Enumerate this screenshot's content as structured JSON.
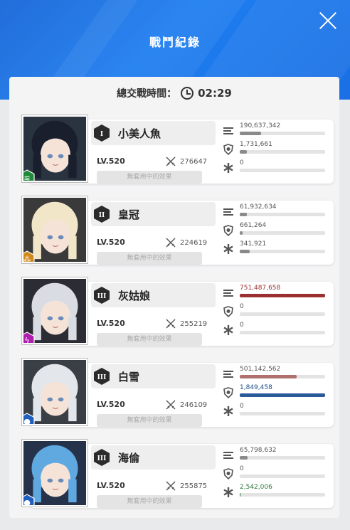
{
  "header": {
    "title": "戰鬥紀錄"
  },
  "battle": {
    "time_label": "總交戰時間：",
    "time_value": "02:29"
  },
  "effect_label": "無套用中的效果",
  "colors": {
    "damage": "#8b2b2b",
    "defense": "#1b4a8a",
    "heal": "#2f7a3a",
    "neutral": "#8a8a8a"
  },
  "characters": [
    {
      "burst": "I",
      "name": "小美人魚",
      "level": "LV.520",
      "combat_power": "276647",
      "element": "wind",
      "element_color": "#1f8a3a",
      "damage": {
        "text": "190,637,342",
        "ratio": 0.25,
        "color": "#8a8a8a",
        "text_color": "#555"
      },
      "defense": {
        "text": "1,731,661",
        "ratio": 0.08,
        "color": "#8a8a8a",
        "text_color": "#555"
      },
      "heal": {
        "text": "0",
        "ratio": 0,
        "color": "#8a8a8a",
        "text_color": "#555"
      }
    },
    {
      "burst": "II",
      "name": "皇冠",
      "level": "LV.520",
      "combat_power": "224619",
      "element": "iron",
      "element_color": "#d28a1a",
      "damage": {
        "text": "61,932,634",
        "ratio": 0.08,
        "color": "#8a8a8a",
        "text_color": "#555"
      },
      "defense": {
        "text": "661,264",
        "ratio": 0.03,
        "color": "#8a8a8a",
        "text_color": "#555"
      },
      "heal": {
        "text": "341,921",
        "ratio": 0.12,
        "color": "#8a8a8a",
        "text_color": "#555"
      }
    },
    {
      "burst": "III",
      "name": "灰姑娘",
      "level": "LV.520",
      "combat_power": "255219",
      "element": "electric",
      "element_color": "#b01fb0",
      "damage": {
        "text": "751,487,658",
        "ratio": 1.0,
        "color": "#9b2f2f",
        "text_color": "#9b2f2f"
      },
      "defense": {
        "text": "0",
        "ratio": 0,
        "color": "#8a8a8a",
        "text_color": "#555"
      },
      "heal": {
        "text": "0",
        "ratio": 0,
        "color": "#8a8a8a",
        "text_color": "#555"
      }
    },
    {
      "burst": "III",
      "name": "白雪",
      "level": "LV.520",
      "combat_power": "246109",
      "element": "water",
      "element_color": "#1f5fbf",
      "damage": {
        "text": "501,142,562",
        "ratio": 0.67,
        "color": "#b07070",
        "text_color": "#555"
      },
      "defense": {
        "text": "1,849,458",
        "ratio": 1.0,
        "color": "#2a5a9a",
        "text_color": "#1b4a8a"
      },
      "heal": {
        "text": "0",
        "ratio": 0,
        "color": "#8a8a8a",
        "text_color": "#555"
      }
    },
    {
      "burst": "III",
      "name": "海倫",
      "level": "LV.520",
      "combat_power": "255875",
      "element": "water",
      "element_color": "#1f5fbf",
      "damage": {
        "text": "65,798,632",
        "ratio": 0.09,
        "color": "#8a8a8a",
        "text_color": "#555"
      },
      "defense": {
        "text": "0",
        "ratio": 0,
        "color": "#8a8a8a",
        "text_color": "#555"
      },
      "heal": {
        "text": "2,542,006",
        "ratio": 0.01,
        "color": "#2f7a3a",
        "text_color": "#2f7a3a"
      }
    }
  ]
}
